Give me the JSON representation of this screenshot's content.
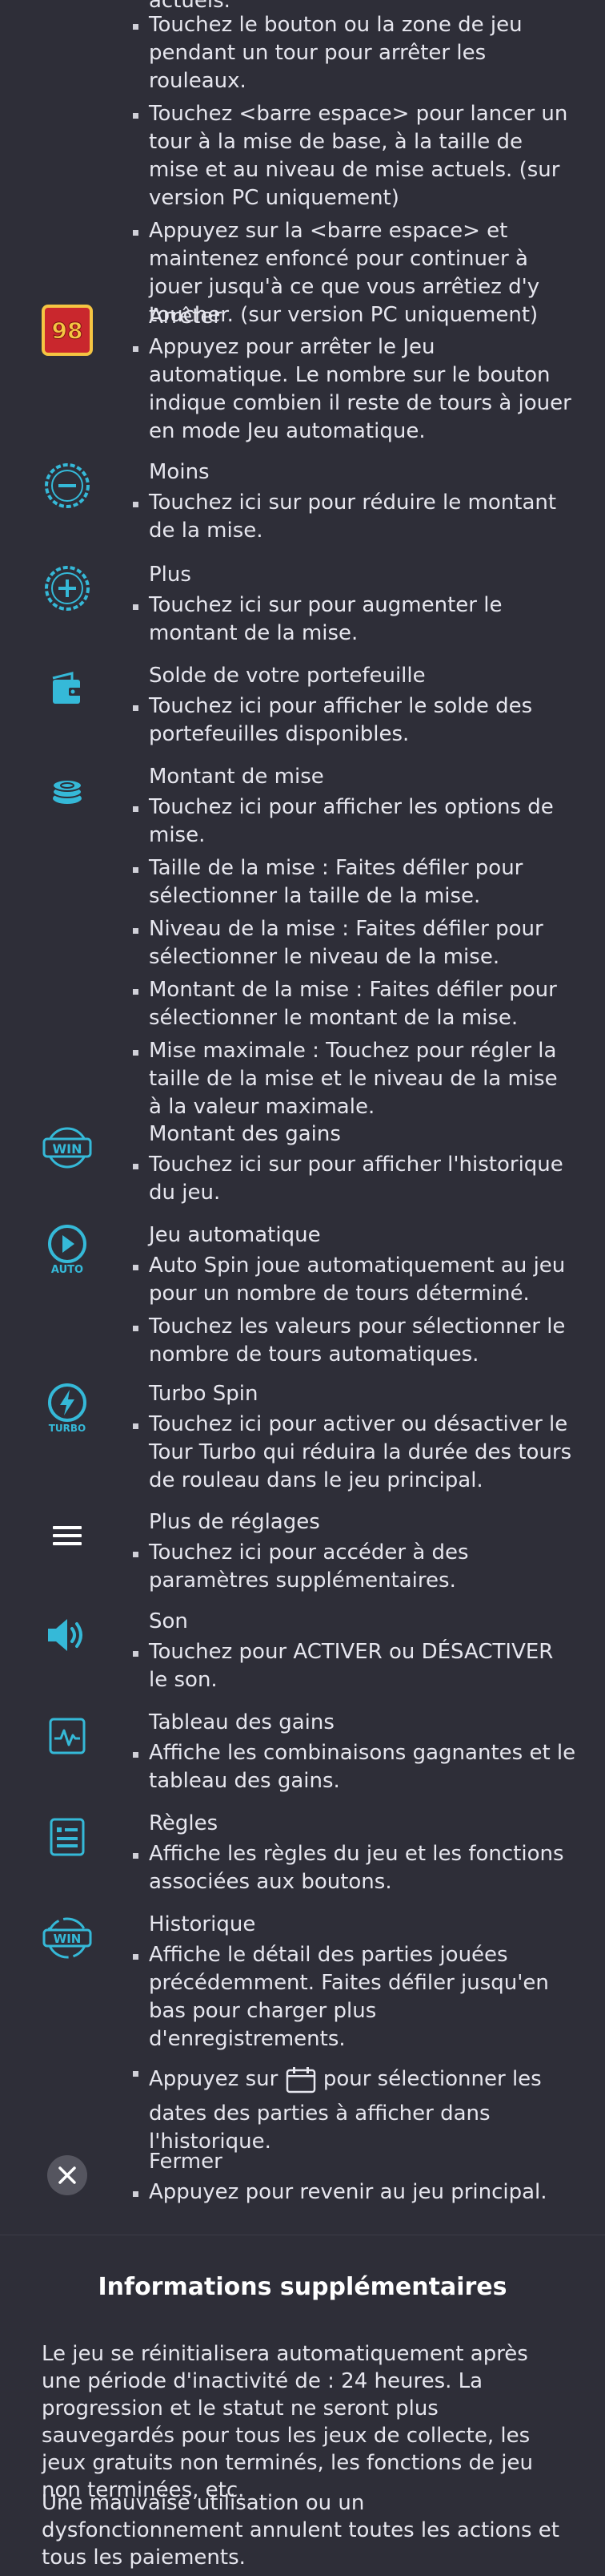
{
  "intro": {
    "cut_top_text": "actuels.",
    "items": [
      "Touchez le bouton ou la zone de jeu pendant un tour pour arrêter les rouleaux.",
      "Touchez <barre espace> pour lancer un tour à la mise de base, à la taille de mise et au niveau de mise actuels. (sur version PC uniquement)",
      "Appuyez sur la <barre espace> et maintenez enfoncé pour continuer à jouer jusqu'à ce que vous arrêtiez d'y toucher. (sur version PC uniquement)"
    ]
  },
  "sections": {
    "stop": {
      "icon": "autoplay-counter-icon",
      "badge": "98",
      "title": "Arrêter",
      "items": [
        "Appuyez pour arrêter le Jeu automatique. Le nombre sur le bouton indique combien il reste de tours à jouer en mode Jeu automatique."
      ]
    },
    "minus": {
      "icon": "minus-icon",
      "title": "Moins",
      "items": [
        "Touchez ici sur pour réduire le montant de la mise."
      ]
    },
    "plus": {
      "icon": "plus-icon",
      "title": "Plus",
      "items": [
        "Touchez ici sur pour augmenter le montant de la mise."
      ]
    },
    "wallet": {
      "icon": "wallet-icon",
      "title": "Solde de votre portefeuille",
      "items": [
        "Touchez ici pour afficher le solde des portefeuilles disponibles."
      ]
    },
    "bet": {
      "icon": "coins-icon",
      "title": "Montant de mise",
      "items": [
        "Touchez ici pour afficher les options de mise.",
        "Taille de la mise : Faites défiler pour sélectionner la taille de la mise.",
        "Niveau de la mise : Faites défiler pour sélectionner le niveau de la mise.",
        "Montant de la mise : Faites défiler pour sélectionner le montant de la mise.",
        "Mise maximale : Touchez pour régler la taille de la mise et le niveau de la mise à la valeur maximale."
      ]
    },
    "win": {
      "icon": "win-icon",
      "badge": "WIN",
      "title": "Montant des gains",
      "items": [
        "Touchez ici sur pour afficher l'historique du jeu."
      ]
    },
    "auto": {
      "icon": "autoplay-icon",
      "badge": "AUTO",
      "title": "Jeu automatique",
      "items": [
        "Auto Spin joue automatiquement au jeu pour un nombre de tours déterminé.",
        "Touchez les valeurs pour sélectionner le nombre de tours automatiques."
      ]
    },
    "turbo": {
      "icon": "turbo-icon",
      "badge": "TURBO",
      "title": "Turbo Spin",
      "items": [
        "Touchez ici pour activer ou désactiver le Tour Turbo qui réduira la durée des tours de rouleau dans le jeu principal."
      ]
    },
    "settings": {
      "icon": "menu-icon",
      "title": "Plus de réglages",
      "items": [
        "Touchez ici pour accéder à des paramètres supplémentaires."
      ]
    },
    "sound": {
      "icon": "speaker-icon",
      "title": "Son",
      "items": [
        "Touchez pour ACTIVER ou DÉSACTIVER le son."
      ]
    },
    "paytable": {
      "icon": "paytable-icon",
      "title": "Tableau des gains",
      "items": [
        "Affiche les combinaisons gagnantes et le tableau des gains."
      ]
    },
    "rules": {
      "icon": "rules-icon",
      "title": "Règles",
      "items": [
        "Affiche les règles du jeu et les fonctions associées aux boutons."
      ]
    },
    "history": {
      "icon": "history-icon",
      "badge": "WIN",
      "title": "Historique",
      "items": [
        "Affiche le détail des parties jouées précédemment. Faites défiler jusqu'en bas pour charger plus d'enregistrements."
      ],
      "calendar_item": {
        "before": "Appuyez sur",
        "after_inline": "pour sélectionner les",
        "rest": "dates des parties à afficher dans l'historique."
      }
    },
    "close": {
      "icon": "close-icon",
      "title": "Fermer",
      "items": [
        "Appuyez pour revenir au jeu principal."
      ]
    }
  },
  "info": {
    "title": "Informations supplémentaires",
    "paragraphs": [
      "Le jeu se réinitialisera automatiquement après une période d'inactivité de : 24 heures. La progression et le statut ne seront plus sauvegardés pour tous les jeux de collecte, les jeux gratuits non terminés, les fonctions de jeu non terminées, etc.",
      "Une mauvaise utilisation ou un dysfonctionnement annulent toutes les actions et tous les paiements."
    ]
  },
  "colors": {
    "background": "#2e2e38",
    "accent": "#35b9d8",
    "badge_red": "#c9272d",
    "badge_gold": "#f5c542"
  }
}
